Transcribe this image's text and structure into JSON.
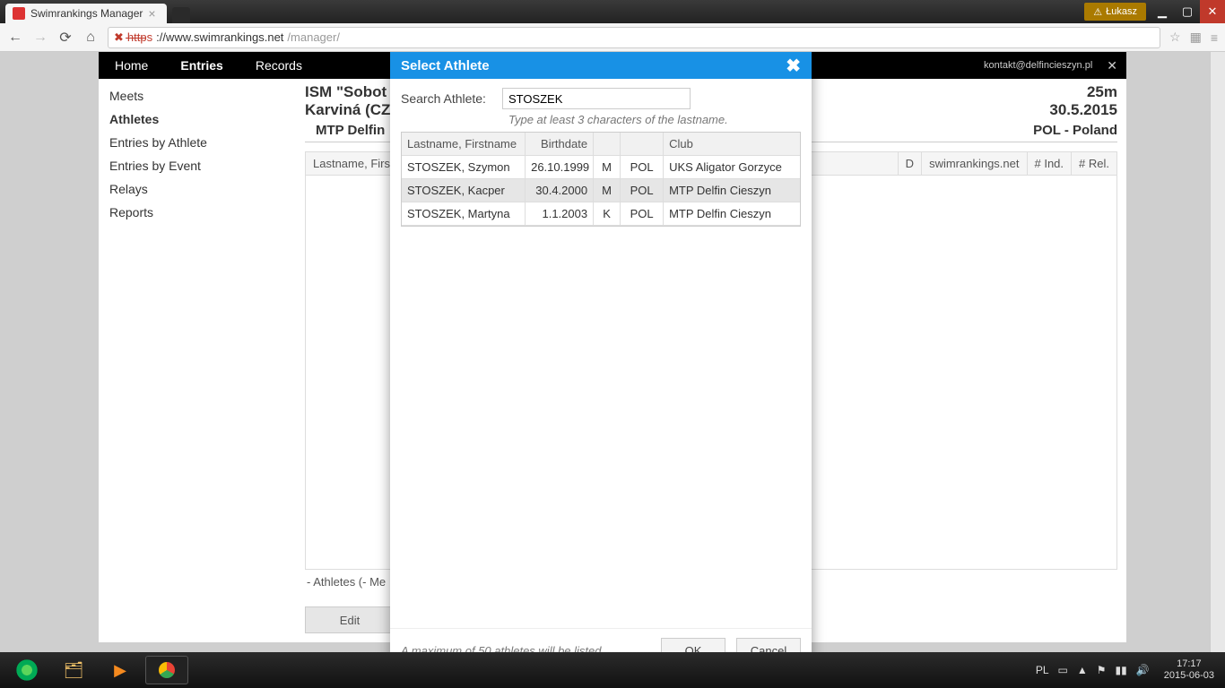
{
  "window": {
    "user": "Łukasz",
    "tab_title": "Swimrankings Manager"
  },
  "browser": {
    "url_scheme": "https",
    "url_host": "://www.swimrankings.net",
    "url_path": "/manager/"
  },
  "topnav": {
    "items": [
      "Home",
      "Entries",
      "Records"
    ],
    "active_index": 1,
    "email": "kontakt@delfincieszyn.pl"
  },
  "sidebar": {
    "items": [
      "Meets",
      "Athletes",
      "Entries by Athlete",
      "Entries by Event",
      "Relays",
      "Reports"
    ],
    "active_index": 1
  },
  "meet": {
    "title_line1": "ISM \"Sobot",
    "title_line2": "Karviná (CZ",
    "pool": "25m",
    "date": "30.5.2015",
    "club": "MTP Delfin",
    "nation": "POL - Poland"
  },
  "bg_table": {
    "col_lastname": "Lastname, First",
    "col_d": "D",
    "col_site": "swimrankings.net",
    "col_ind": "# Ind.",
    "col_rel": "# Rel."
  },
  "below_note": "- Athletes (- Me",
  "edit_label": "Edit",
  "modal": {
    "title": "Select Athlete",
    "search_label": "Search Athlete:",
    "search_value": "STOSZEK",
    "hint": "Type at least 3 characters of the lastname.",
    "headers": {
      "name": "Lastname, Firstname",
      "birth": "Birthdate",
      "club": "Club"
    },
    "rows": [
      {
        "name": "STOSZEK, Szymon",
        "birth": "26.10.1999",
        "sex": "M",
        "nat": "POL",
        "club": "UKS Aligator Gorzyce",
        "selected": false
      },
      {
        "name": "STOSZEK, Kacper",
        "birth": "30.4.2000",
        "sex": "M",
        "nat": "POL",
        "club": "MTP Delfin Cieszyn",
        "selected": true
      },
      {
        "name": "STOSZEK, Martyna",
        "birth": "1.1.2003",
        "sex": "K",
        "nat": "POL",
        "club": "MTP Delfin Cieszyn",
        "selected": false
      }
    ],
    "footer_note": "A maximum of 50 athletes will be listed.",
    "ok": "OK",
    "cancel": "Cancel"
  },
  "tray": {
    "lang": "PL",
    "time": "17:17",
    "date": "2015-06-03"
  }
}
